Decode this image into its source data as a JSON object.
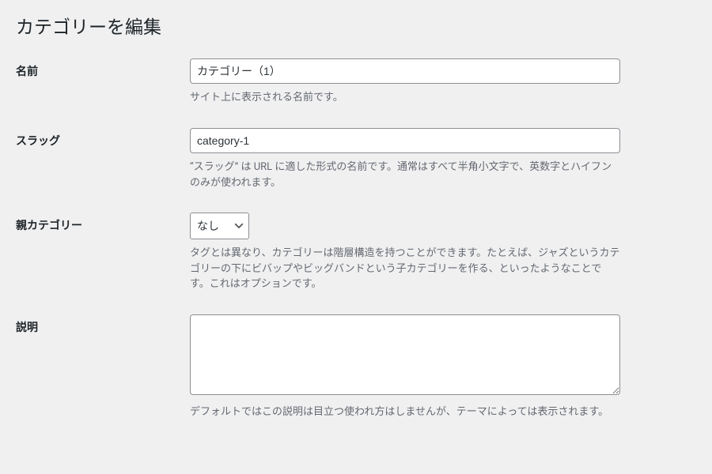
{
  "page_title": "カテゴリーを編集",
  "fields": {
    "name": {
      "label": "名前",
      "value": "カテゴリー（1）",
      "description": "サイト上に表示される名前です。"
    },
    "slug": {
      "label": "スラッグ",
      "value": "category-1",
      "description": "“スラッグ” は URL に適した形式の名前です。通常はすべて半角小文字で、英数字とハイフンのみが使われます。"
    },
    "parent": {
      "label": "親カテゴリー",
      "selected": "なし",
      "description": "タグとは異なり、カテゴリーは階層構造を持つことができます。たとえば、ジャズというカテゴリーの下にビバップやビッグバンドという子カテゴリーを作る、といったようなことです。これはオプションです。"
    },
    "description": {
      "label": "説明",
      "value": "",
      "description": "デフォルトではこの説明は目立つ使われ方はしませんが、テーマによっては表示されます。"
    }
  }
}
